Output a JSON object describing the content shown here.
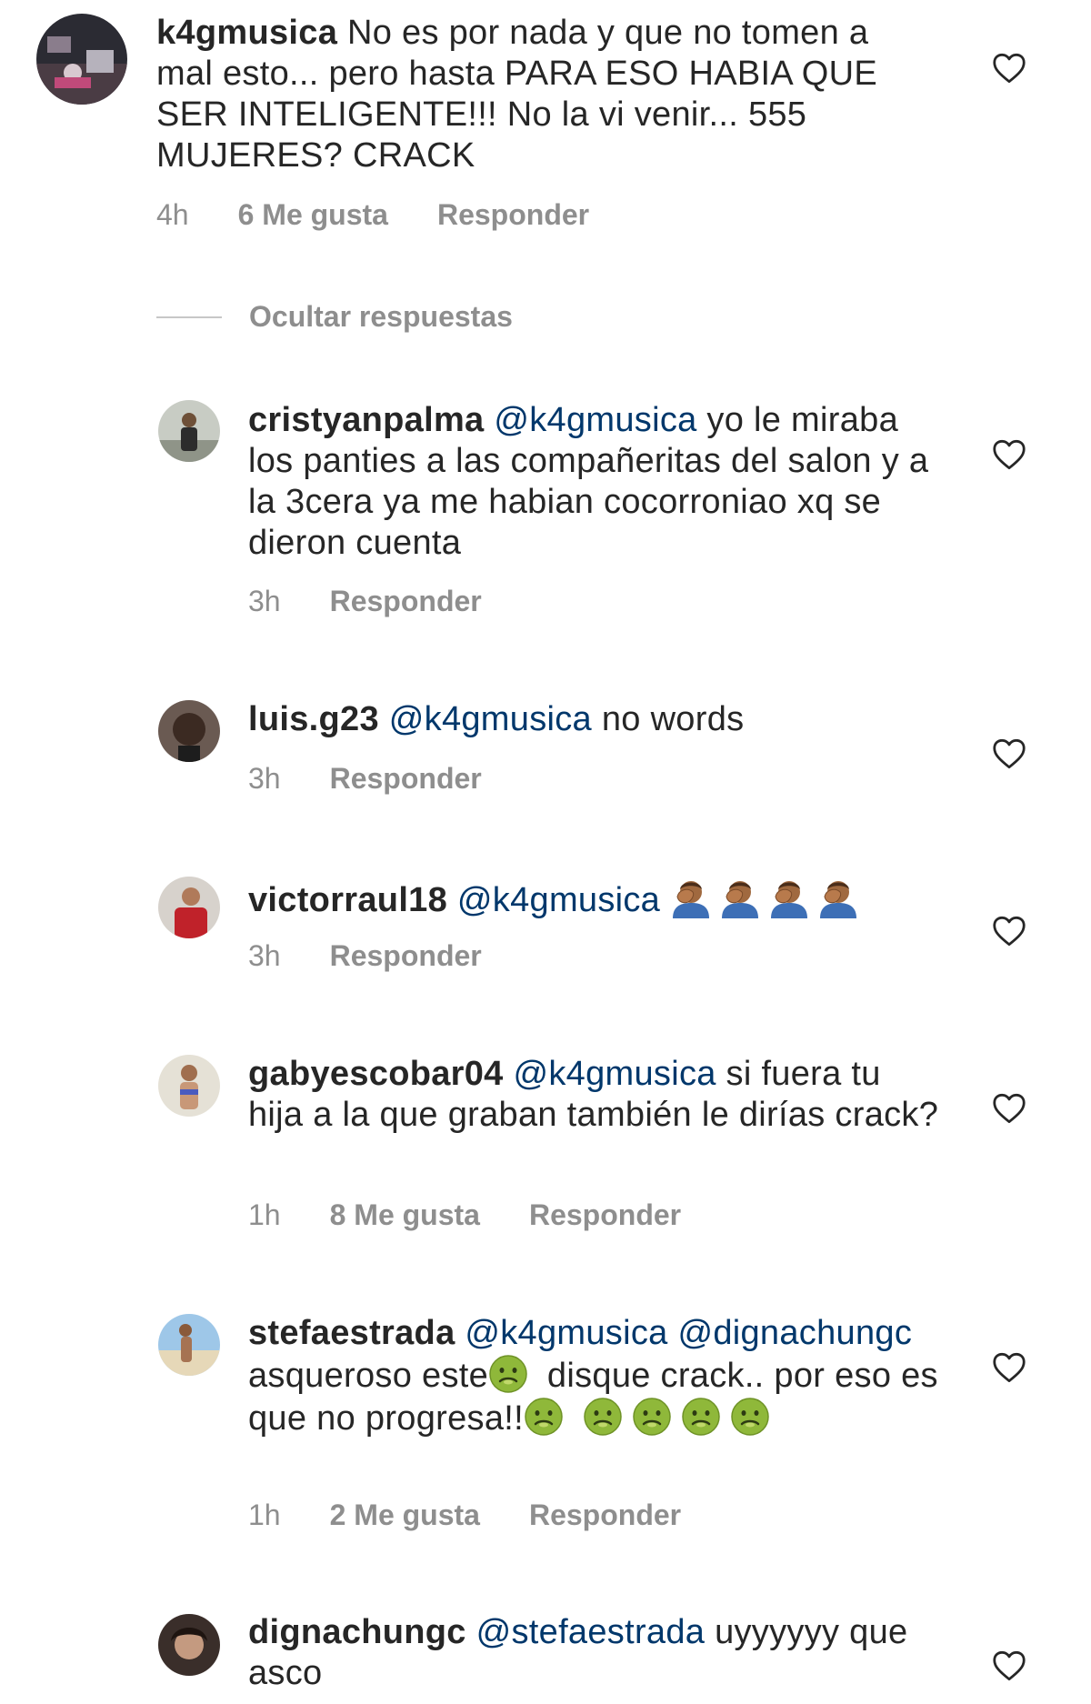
{
  "comments": [
    {
      "username": "k4gmusica",
      "text": " No es por nada y que no tomen a mal esto... pero hasta PARA ESO HABIA QUE SER INTELIGENTE!!! No la vi venir... 555 MUJERES? CRACK",
      "time": "4h",
      "likes": "6 Me gusta",
      "reply": "Responder"
    },
    {
      "username": "cristyanpalma",
      "mention": "@k4gmusica",
      "text": " yo le miraba los panties a las compañeritas del salon y a la 3cera ya me habian cocorroniao xq se dieron cuenta",
      "time": "3h",
      "reply": "Responder"
    },
    {
      "username": "luis.g23",
      "mention": "@k4gmusica",
      "text": " no words",
      "time": "3h",
      "reply": "Responder"
    },
    {
      "username": "victorraul18",
      "mention": "@k4gmusica",
      "text": " 🤦🏽‍♂️🤦🏽‍♂️🤦🏽‍♂️🤦🏽‍♂️",
      "time": "3h",
      "reply": "Responder"
    },
    {
      "username": "gabyescobar04",
      "mention": "@k4gmusica",
      "text": " si fuera tu hija a la que graban también le dirías crack?",
      "time": "1h",
      "likes": "8 Me gusta",
      "reply": "Responder"
    },
    {
      "username": "stefaestrada",
      "mention": "@k4gmusica",
      "mention2": "@dignachungc",
      "text_a": " asqueroso este",
      "text_b": " disque crack.. por eso es que no progresa!!",
      "emoji": "🤢",
      "time": "1h",
      "likes": "2 Me gusta",
      "reply": "Responder"
    },
    {
      "username": "dignachungc",
      "mention": "@stefaestrada",
      "text": " uyyyyyy que asco"
    }
  ],
  "hide_replies": "Ocultar respuestas",
  "colors": {
    "text": "#262626",
    "secondary": "#8e8e8e",
    "mention": "#00376b"
  },
  "icons": {
    "like": "heart-outline-icon",
    "facepalm": "person-facepalming-emoji",
    "nauseated": "nauseated-face-emoji"
  }
}
